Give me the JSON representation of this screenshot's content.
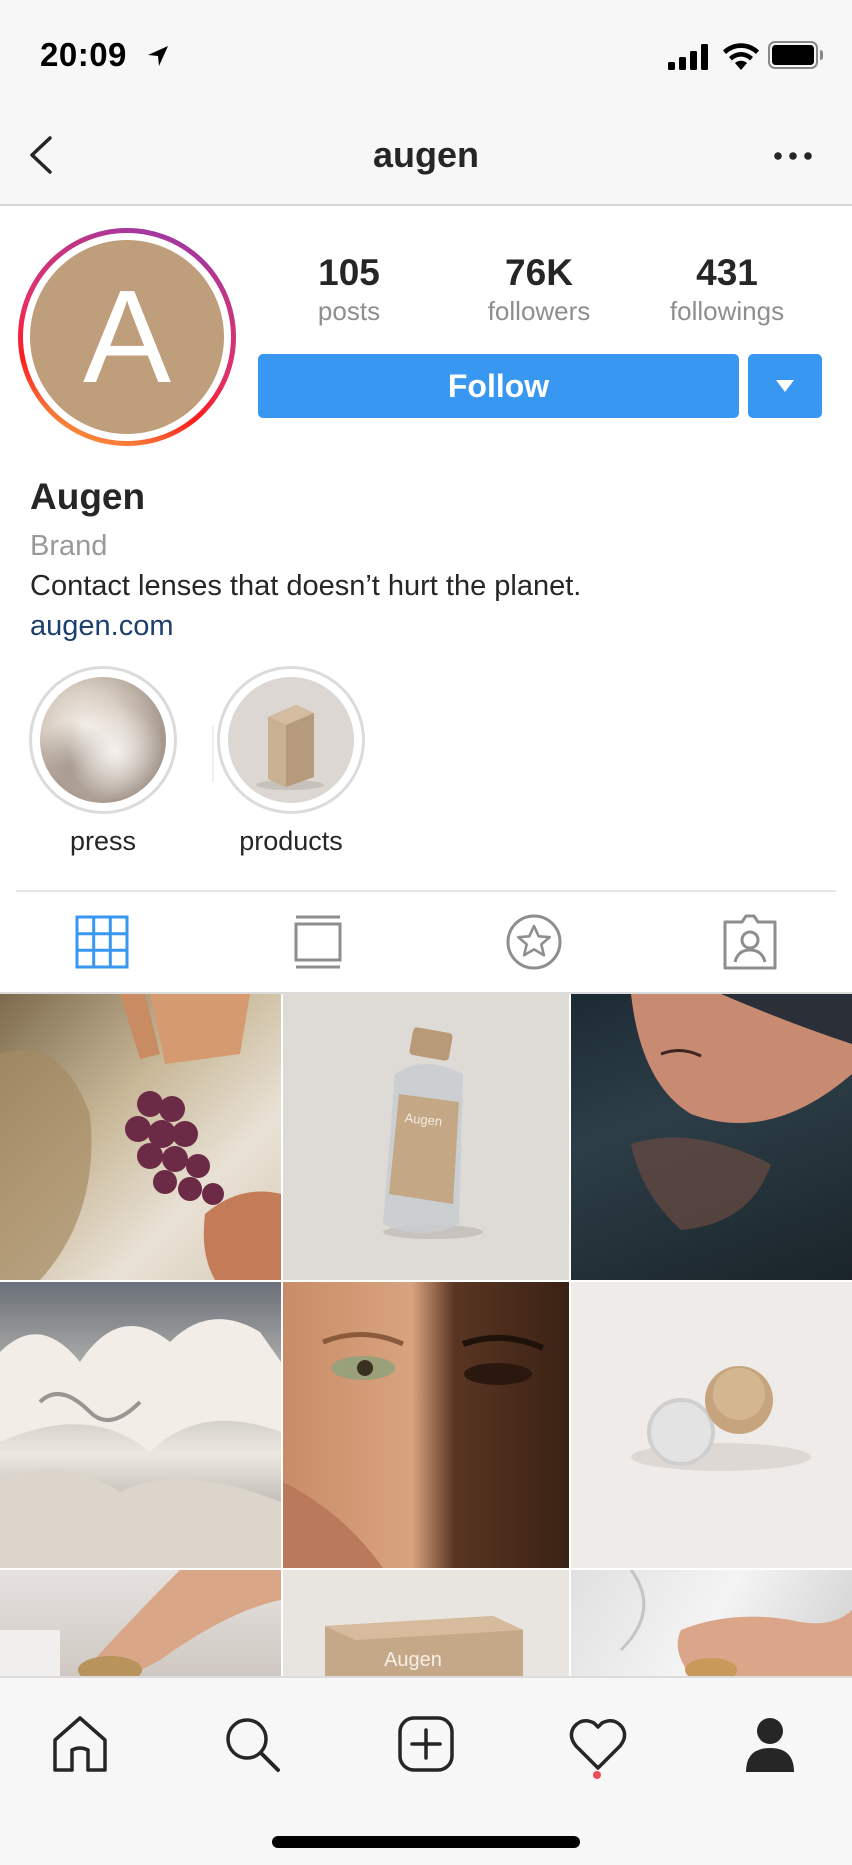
{
  "status_bar": {
    "time": "20:09"
  },
  "nav": {
    "title": "augen"
  },
  "profile": {
    "avatar_letter": "A",
    "stats": [
      {
        "value": "105",
        "label": "posts"
      },
      {
        "value": "76K",
        "label": "followers"
      },
      {
        "value": "431",
        "label": "followings"
      }
    ],
    "follow_label": "Follow",
    "name": "Augen",
    "category": "Brand",
    "bio": "Contact lenses that doesn’t hurt the planet.",
    "link": "augen.com"
  },
  "highlights": [
    {
      "label": "press"
    },
    {
      "label": "products"
    }
  ],
  "tile_text": {
    "bottle": "Augen",
    "box": "Augen"
  },
  "colors": {
    "accent": "#3897f0",
    "link": "#1d3f6e",
    "brand": "#bf9f7b",
    "notification": "#ed4956"
  },
  "icons": {
    "tabs": [
      "grid-icon",
      "feed-icon",
      "star-icon",
      "tagged-icon"
    ],
    "bottom_bar": [
      "home-icon",
      "search-icon",
      "add-post-icon",
      "activity-icon",
      "profile-icon"
    ]
  }
}
